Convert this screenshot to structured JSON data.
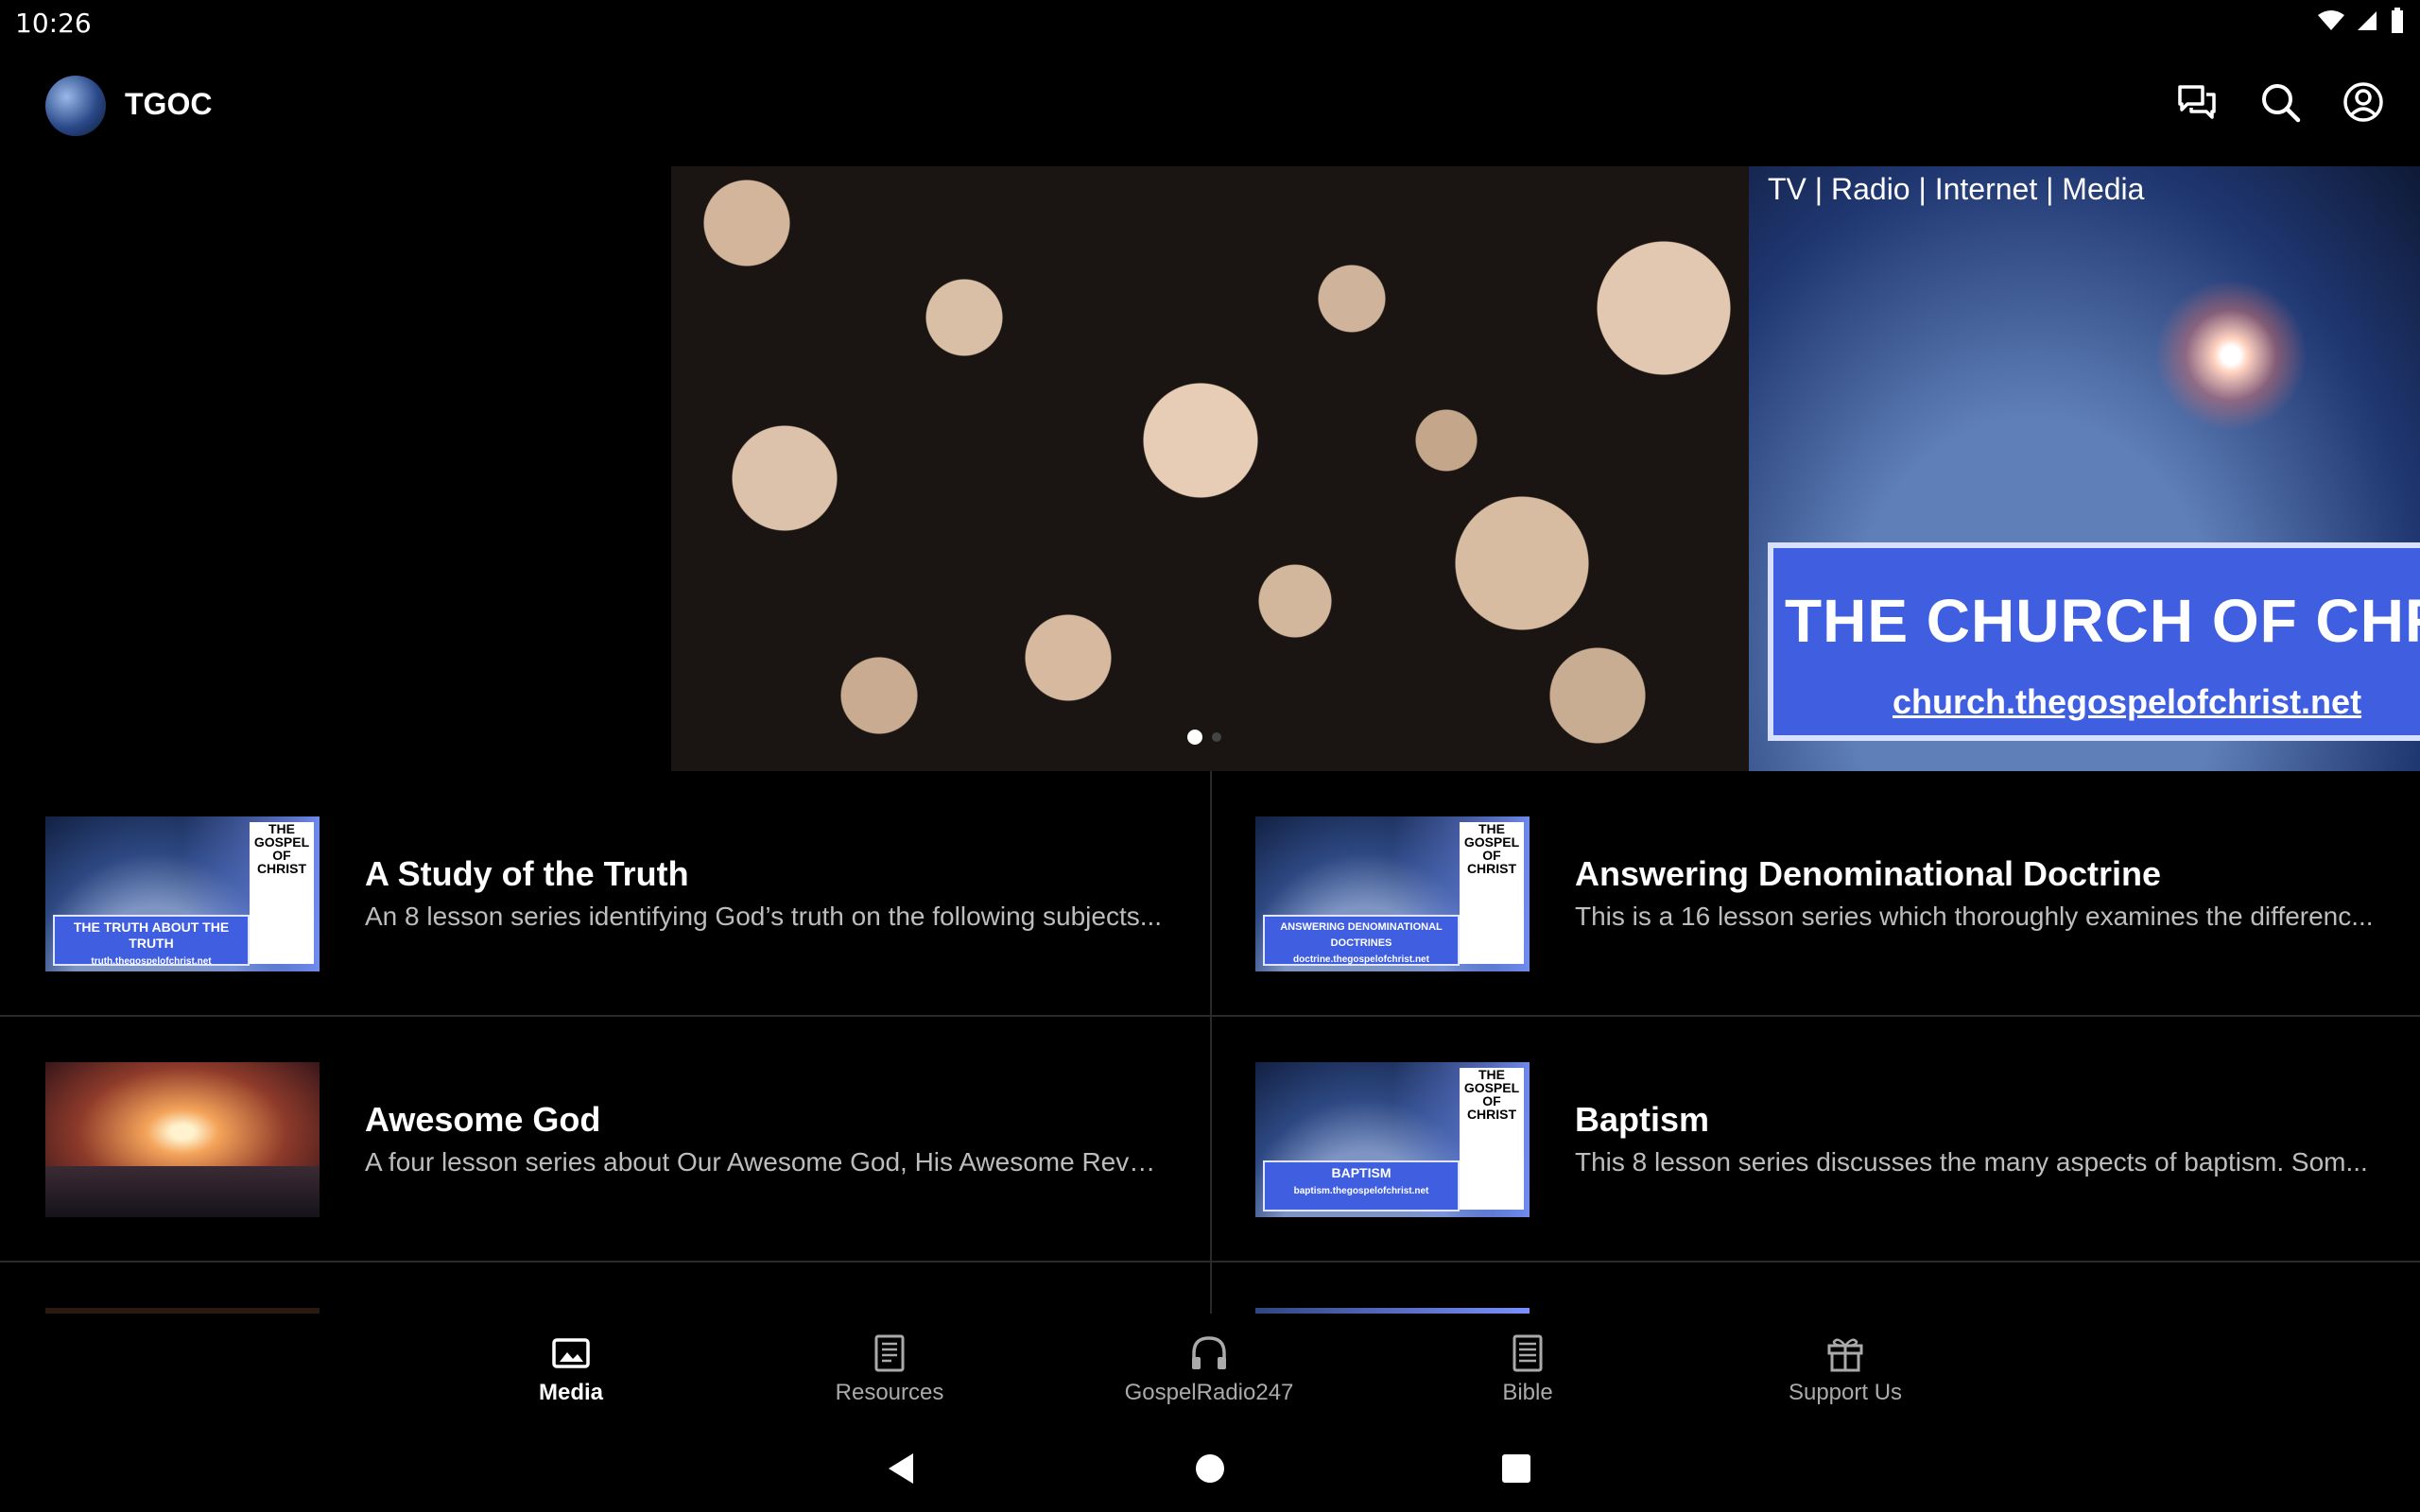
{
  "status": {
    "time": "10:26"
  },
  "app": {
    "title": "TGOC"
  },
  "hero": {
    "slide2_tag": "TV | Radio | Internet | Media",
    "slide2_banner": "THE CHURCH OF CHR",
    "slide2_url": "church.thegospelofchrist.net",
    "active_index": 0,
    "slide_count": 2
  },
  "items": [
    {
      "title": "A Study of the Truth",
      "desc": "An 8 lesson series identifying God’s truth on the following subjects...",
      "thumb_panel": "THE TRUTH ABOUT THE TRUTH",
      "thumb_url": "truth.thegospelofchrist.net"
    },
    {
      "title": "Answering Denominational Doctrine",
      "desc": "This is a 16 lesson series which thoroughly examines the differenc...",
      "thumb_panel": "ANSWERING DENOMINATIONAL DOCTRINES",
      "thumb_url": "doctrine.thegospelofchrist.net"
    },
    {
      "title": "Awesome God",
      "desc": "A four lesson series about Our Awesome God, His Awesome Revel..."
    },
    {
      "title": "Baptism",
      "desc": "This 8 lesson series discusses the many aspects of baptism. Som...",
      "thumb_panel": "BAPTISM",
      "thumb_url": "baptism.thegospelofchrist.net"
    }
  ],
  "thumb_brand": "THE GOSPEL OF CHRIST",
  "thumb_header": "TV | Radio | Internet | Media",
  "nav": [
    {
      "label": "Media",
      "icon": "image-icon",
      "active": true
    },
    {
      "label": "Resources",
      "icon": "book-icon"
    },
    {
      "label": "GospelRadio247",
      "icon": "headphones-icon"
    },
    {
      "label": "Bible",
      "icon": "bible-icon"
    },
    {
      "label": "Support Us",
      "icon": "gift-icon"
    }
  ],
  "colors": {
    "accent_blue": "#3f5fe0",
    "background": "#000000",
    "divider": "#2a2a2a"
  }
}
